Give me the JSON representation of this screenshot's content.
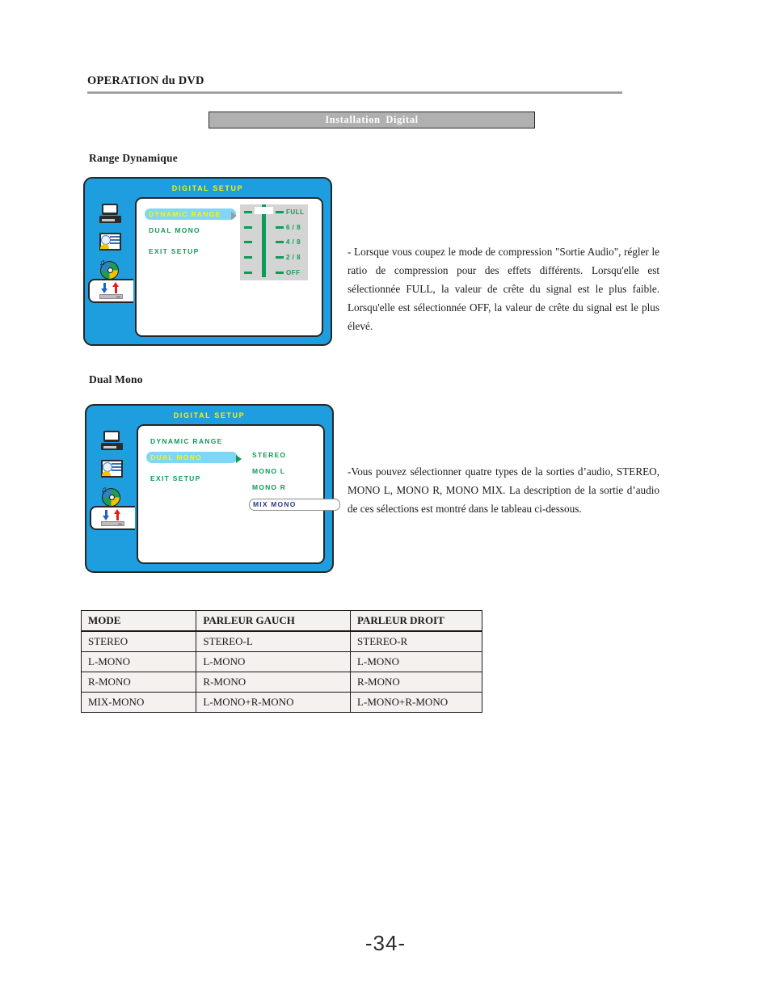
{
  "header": {
    "title": "OPERATION du DVD"
  },
  "banner": {
    "label": "Installation  Digital"
  },
  "sections": {
    "range_heading": "Range Dynamique",
    "dual_heading": "Dual Mono"
  },
  "osd_range": {
    "title": "DIGITAL SETUP",
    "menu": [
      {
        "label": "DYNAMIC RANGE",
        "selected": true
      },
      {
        "label": "DUAL MONO",
        "selected": false
      },
      {
        "label": "EXIT SETUP",
        "selected": false
      }
    ],
    "slider": {
      "options": [
        "FULL",
        "6 / 8",
        "4 / 8",
        "2 / 8",
        "OFF"
      ],
      "current": "FULL"
    },
    "icons": [
      "monitor-icon",
      "video-card-icon",
      "disc-icon",
      "audio-setup-icon"
    ],
    "arrow": "chevron-right-icon"
  },
  "osd_dual": {
    "title": "DIGITAL SETUP",
    "menu": [
      {
        "label": "DYNAMIC RANGE",
        "selected": false
      },
      {
        "label": "DUAL MONO",
        "selected": true
      },
      {
        "label": "EXIT SETUP",
        "selected": false
      }
    ],
    "submenu": [
      {
        "label": "STEREO",
        "boxed": false
      },
      {
        "label": "MONO L",
        "boxed": false
      },
      {
        "label": "MONO R",
        "boxed": false
      },
      {
        "label": "MIX MONO",
        "boxed": true
      }
    ],
    "icons": [
      "monitor-icon",
      "video-card-icon",
      "disc-icon",
      "audio-setup-icon"
    ],
    "arrow": "chevron-right-icon"
  },
  "paragraphs": {
    "range": "- Lorsque vous coupez le mode de compression \"Sortie Audio\", régler le ratio de compression pour des effets différents. Lorsqu'elle est sélectionnée FULL, la valeur de crête du signal est le plus faible. Lorsqu'elle est sélectionnée OFF, la valeur de crête du signal est le plus élevé.",
    "dual": "-Vous pouvez sélectionner quatre types de la sorties d’audio, STEREO, MONO L, MONO R, MONO MIX. La description de la sortie d’audio de ces sélections est montré dans le tableau ci-dessous."
  },
  "table": {
    "headers": [
      "MODE",
      "PARLEUR GAUCH",
      "PARLEUR DROIT"
    ],
    "rows": [
      [
        "STEREO",
        "STEREO-L",
        "STEREO-R"
      ],
      [
        "L-MONO",
        "L-MONO",
        "L-MONO"
      ],
      [
        "R-MONO",
        "R-MONO",
        "R-MONO"
      ],
      [
        "MIX-MONO",
        "L-MONO+R-MONO",
        "L-MONO+R-MONO"
      ]
    ]
  },
  "footer": {
    "page_number": "-34-"
  },
  "colors": {
    "osd_background": "#1e9ede",
    "osd_title": "#fff200",
    "menu_text": "#0e9b57",
    "highlight_pill": "#7fd6f7",
    "highlight_text": "#fff200",
    "boxed_text": "#2a3a8c",
    "banner": "#b0b0b0"
  }
}
